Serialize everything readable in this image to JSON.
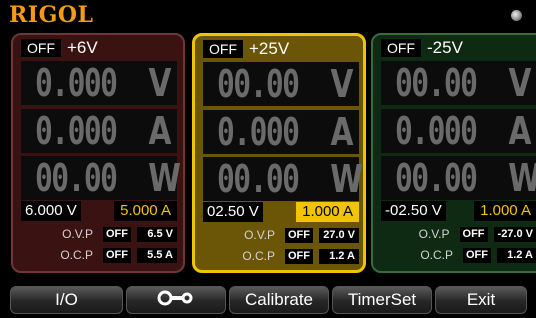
{
  "header": {
    "logo": "RIGOL"
  },
  "channels": [
    {
      "state": "OFF",
      "name": "+6V",
      "voltage": "0.000",
      "voltage_unit": "V",
      "current": "0.000",
      "current_unit": "A",
      "power": "00.00",
      "power_unit": "W",
      "set_voltage": "6.000 V",
      "set_current": "5.000 A",
      "ovp_label": "O.V.P",
      "ovp_state": "OFF",
      "ovp_value": "6.5 V",
      "ocp_label": "O.C.P",
      "ocp_state": "OFF",
      "ocp_value": "5.5 A",
      "color": "#3a1212"
    },
    {
      "state": "OFF",
      "name": "+25V",
      "voltage": "00.00",
      "voltage_unit": "V",
      "current": "0.000",
      "current_unit": "A",
      "power": "00.00",
      "power_unit": "W",
      "set_voltage": "02.50 V",
      "set_current": "1.000 A",
      "ovp_label": "O.V.P",
      "ovp_state": "OFF",
      "ovp_value": "27.0 V",
      "ocp_label": "O.C.P",
      "ocp_state": "OFF",
      "ocp_value": "1.2 A",
      "color": "#6a5606"
    },
    {
      "state": "OFF",
      "name": "-25V",
      "voltage": "00.00",
      "voltage_unit": "V",
      "current": "0.000",
      "current_unit": "A",
      "power": "00.00",
      "power_unit": "W",
      "set_voltage": "-02.50 V",
      "set_current": "1.000 A",
      "ovp_label": "O.V.P",
      "ovp_state": "OFF",
      "ovp_value": "-27.0 V",
      "ocp_label": "O.C.P",
      "ocp_state": "OFF",
      "ocp_value": "1.2 A",
      "color": "#0f2a12"
    }
  ],
  "softkeys": {
    "io": "I/O",
    "key_icon": "key-icon",
    "calibrate": "Calibrate",
    "timerset": "TimerSet",
    "exit": "Exit"
  },
  "colors": {
    "accent": "#f2c400",
    "logo": "#f39c12"
  }
}
